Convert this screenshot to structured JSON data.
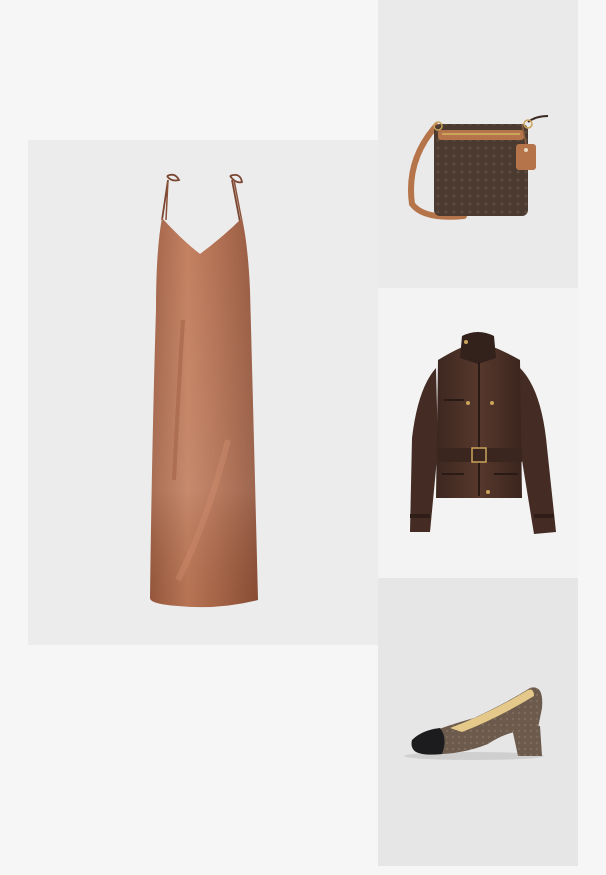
{
  "outfit": {
    "items": [
      {
        "product": "slip-dress"
      },
      {
        "product": "crossbody-bag"
      },
      {
        "product": "leather-jacket"
      },
      {
        "product": "block-heel-pump"
      }
    ]
  },
  "colors": {
    "page_background": "#f6f6f6",
    "dress": "#b0684a",
    "bag_monogram": "#4a3a30",
    "bag_trim": "#b5744a",
    "jacket": "#4a3027",
    "shoe_body": "#6c5a4c",
    "shoe_toe": "#1c1c1e",
    "hardware_gold": "#c9a45a"
  }
}
